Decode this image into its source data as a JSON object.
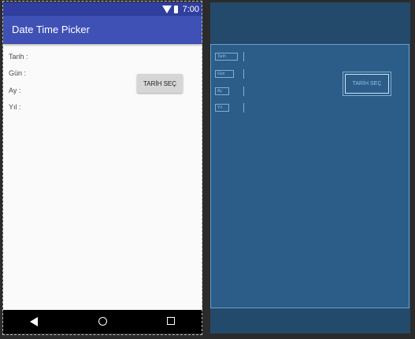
{
  "status_bar": {
    "time": "7:00"
  },
  "app_bar": {
    "title": "Date Time Picker"
  },
  "form": {
    "labels": [
      "Tarih :",
      "Gün :",
      "Ay :",
      "Yıl :"
    ],
    "button_label": "TARİH SEÇ"
  },
  "blueprint": {
    "labels": [
      "Tarih",
      "Gün",
      "Ay",
      "Yıl"
    ],
    "button_label": "TARİH SEÇ"
  },
  "colors": {
    "primary": "#3f51b5",
    "primary_dark": "#303f9f",
    "blueprint_bg": "#2b5d88"
  }
}
